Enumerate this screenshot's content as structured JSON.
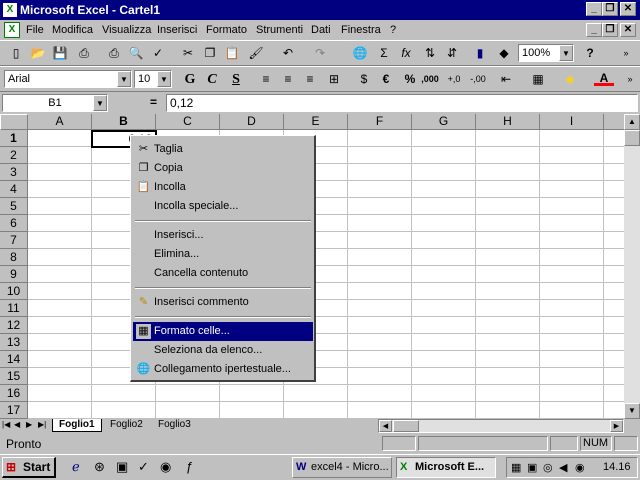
{
  "window": {
    "title": "Microsoft Excel - Cartel1",
    "minimize": "_",
    "restore": "❐",
    "close": "✕"
  },
  "menu": {
    "items": [
      "File",
      "Modifica",
      "Visualizza",
      "Inserisci",
      "Formato",
      "Strumenti",
      "Dati",
      "Finestra",
      "?"
    ]
  },
  "toolbar": {
    "zoom": "100%",
    "sigma": "Σ",
    "fx": "fx",
    "help": "?"
  },
  "format_toolbar": {
    "font": "Arial",
    "size": "10",
    "bold": "G",
    "italic": "C",
    "underline": "S",
    "euro": "€",
    "percent": "%",
    "thousands": ",000",
    "inc_dec": "+,0",
    "dec_dec": "-,00",
    "font_color": "A"
  },
  "formula_bar": {
    "cell_ref": "B1",
    "equals": "=",
    "content": "0,12"
  },
  "sheet": {
    "columns": [
      "A",
      "B",
      "C",
      "D",
      "E",
      "F",
      "G",
      "H",
      "I"
    ],
    "rows": [
      "1",
      "2",
      "3",
      "4",
      "5",
      "6",
      "7",
      "8",
      "9",
      "10",
      "11",
      "12",
      "13",
      "14",
      "15",
      "16",
      "17"
    ],
    "b1_value": "0,12"
  },
  "context_menu": {
    "items": [
      {
        "label": "Taglia",
        "icon": "scissors-icon",
        "glyph": "✂"
      },
      {
        "label": "Copia",
        "icon": "copy-icon",
        "glyph": "❐"
      },
      {
        "label": "Incolla",
        "icon": "paste-icon",
        "glyph": "📋"
      },
      {
        "label": "Incolla speciale...",
        "icon": "",
        "glyph": ""
      },
      {
        "label": "Inserisci...",
        "icon": "",
        "glyph": ""
      },
      {
        "label": "Elimina...",
        "icon": "",
        "glyph": ""
      },
      {
        "label": "Cancella contenuto",
        "icon": "",
        "glyph": ""
      },
      {
        "label": "Inserisci commento",
        "icon": "comment-icon",
        "glyph": "✎"
      },
      {
        "label": "Formato celle...",
        "icon": "format-cells-icon",
        "glyph": "▦"
      },
      {
        "label": "Seleziona da elenco...",
        "icon": "",
        "glyph": ""
      },
      {
        "label": "Collegamento ipertestuale...",
        "icon": "hyperlink-icon",
        "glyph": "🌐"
      }
    ]
  },
  "sheet_tabs": [
    "Foglio1",
    "Foglio2",
    "Foglio3"
  ],
  "status": {
    "text": "Pronto",
    "num": "NUM"
  },
  "taskbar": {
    "start": "Start",
    "task1": "excel4 - Micro...",
    "task2": "Microsoft E...",
    "clock": "14.16"
  }
}
